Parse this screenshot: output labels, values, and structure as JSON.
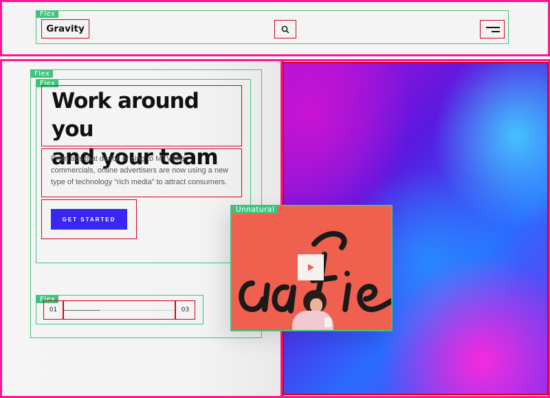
{
  "header": {
    "flex_tag": "Flex",
    "logo": "Gravity",
    "search_icon": "search-icon",
    "menu_icon": "menu-icon"
  },
  "hero": {
    "outer_flex_tag": "Flex",
    "inner_flex_tag": "Flex",
    "headline_line1": "Work around you",
    "headline_line2": "and your team",
    "paragraph": "From ads that dance or sing to MTV-like commercials, online advertisers are now using a new type of technology “rich media” to attract consumers.",
    "cta_label": "GET STARTED"
  },
  "slider": {
    "flex_tag": "Flex",
    "current": "01",
    "total": "03",
    "progress": 0.33
  },
  "video": {
    "tag": "Unnatural",
    "play_icon": "play-icon",
    "background_color": "#f0604f"
  },
  "colors": {
    "outline_pink": "#ff1493",
    "outline_green": "#3cc47c",
    "outline_red": "#d0021b",
    "cta": "#3a26f2"
  }
}
